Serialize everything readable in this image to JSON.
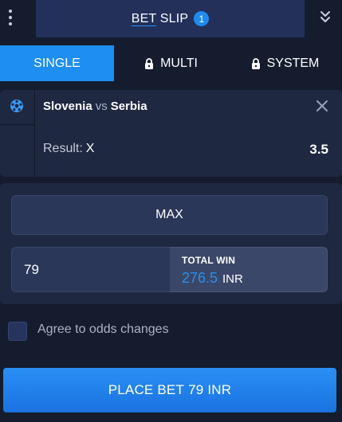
{
  "header": {
    "title_part1": "BET",
    "title_part2": "SLIP",
    "count": "1"
  },
  "tabs": [
    {
      "label": "SINGLE",
      "active": true,
      "icon": null
    },
    {
      "label": "MULTI",
      "active": false,
      "icon": "lock-icon"
    },
    {
      "label": "SYSTEM",
      "active": false,
      "icon": "lock-icon"
    }
  ],
  "bet": {
    "sport_icon": "football-icon",
    "home": "Slovenia",
    "vs": "vs",
    "away": "Serbia",
    "result_label": "Result:",
    "result_pick": "X",
    "odds": "3.5"
  },
  "stake": {
    "max_label": "MAX",
    "value": "79",
    "total_win_label": "TOTAL WIN",
    "total_win_amount": "276.5",
    "currency": "INR"
  },
  "agree": {
    "label": "Agree to odds changes",
    "checked": false
  },
  "place_bet": {
    "label": "PLACE BET",
    "amount": "79",
    "currency": "INR"
  },
  "colors": {
    "background": "#141c2e",
    "panel": "#1e2840",
    "header_box": "#22305a",
    "accent": "#1e8ef2",
    "win_amount": "#2a8ff0"
  }
}
